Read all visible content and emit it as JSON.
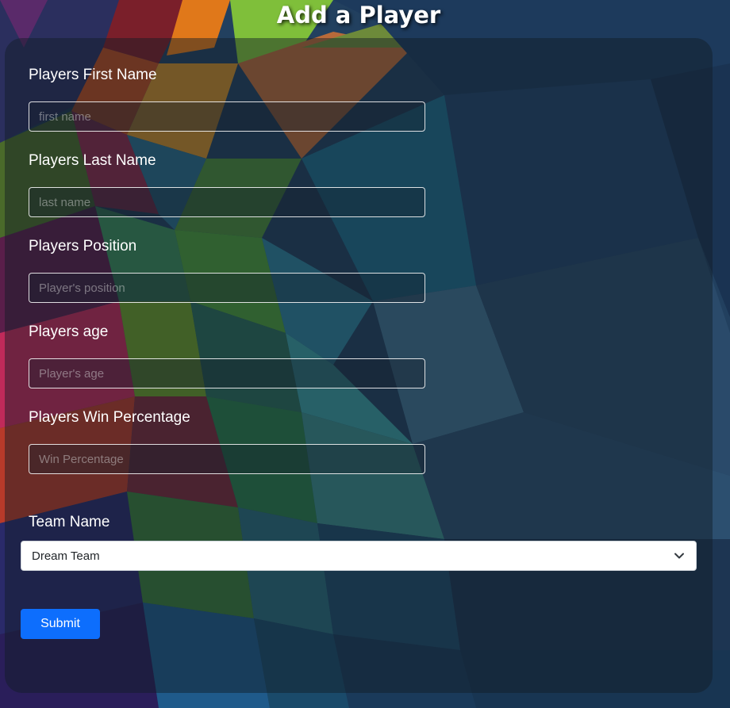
{
  "page": {
    "title": "Add a Player"
  },
  "form": {
    "first_name": {
      "label": "Players First Name",
      "placeholder": "first name",
      "value": ""
    },
    "last_name": {
      "label": "Players Last Name",
      "placeholder": "last name",
      "value": ""
    },
    "position": {
      "label": "Players Position",
      "placeholder": "Player's position",
      "value": ""
    },
    "age": {
      "label": "Players age",
      "placeholder": "Player's age",
      "value": ""
    },
    "win_percentage": {
      "label": "Players Win Percentage",
      "placeholder": "Win Percentage",
      "value": ""
    },
    "team": {
      "label": "Team Name",
      "selected": "Dream Team",
      "icon": "chevron-down-icon"
    },
    "submit_label": "Submit"
  },
  "colors": {
    "submit_button": "#0d6efd",
    "label_text": "#ffffff",
    "panel_overlay": "rgba(18, 28, 38, 0.46)"
  }
}
